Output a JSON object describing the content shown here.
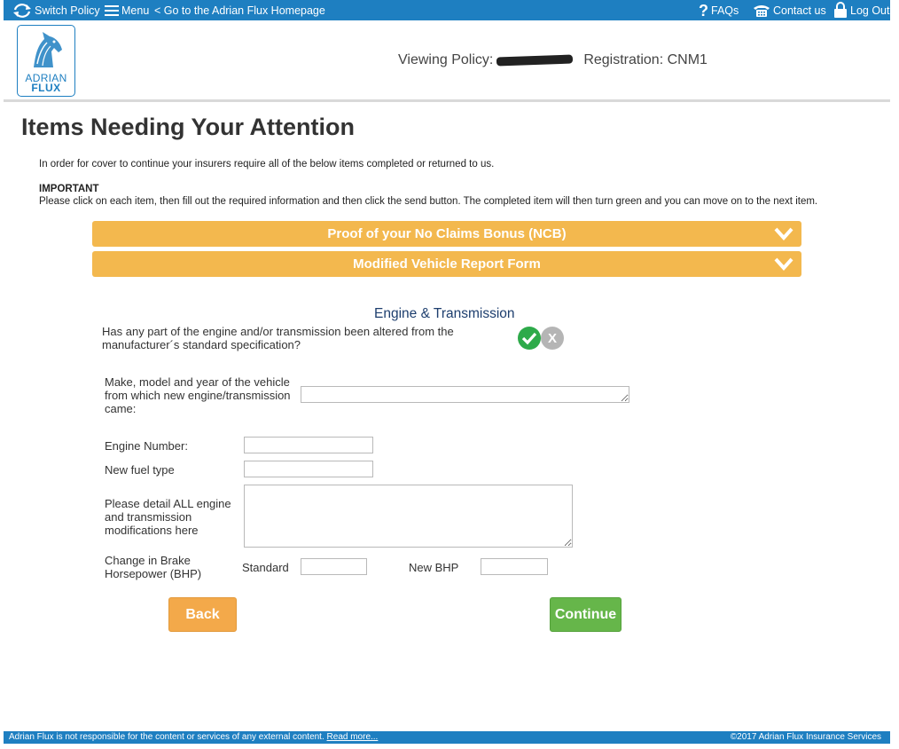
{
  "topbar": {
    "switch_policy": "Switch Policy",
    "menu": "Menu",
    "homepage_link": "< Go to the Adrian Flux Homepage",
    "faqs": "FAQs",
    "contact": "Contact us",
    "logout": "Log Out"
  },
  "header": {
    "logo_line1": "ADRIAN",
    "logo_line2": "FLUX",
    "viewing_policy_label": "Viewing Policy:",
    "registration": "Registration: CNM1"
  },
  "page": {
    "title": "Items Needing Your Attention",
    "intro": "In order for cover to continue your insurers require all of the below items completed or returned to us.",
    "important_label": "IMPORTANT",
    "instruction": "Please click on each item, then fill out the required information and then click the send button. The completed item will then turn green and you can move on to the next item."
  },
  "accordions": [
    {
      "label": "Proof of your No Claims Bonus (NCB)"
    },
    {
      "label": "Modified Vehicle Report Form"
    }
  ],
  "form": {
    "section_title": "Engine & Transmission",
    "altered_question": "Has any part of the engine and/or transmission been altered from the manufacturer´s standard specification?",
    "no_label": "X",
    "make_model_label": "Make, model and year of the vehicle from which new engine/transmission came:",
    "make_model_value": "",
    "engine_number_label": "Engine Number:",
    "engine_number_value": "",
    "fuel_type_label": "New fuel type",
    "fuel_type_value": "",
    "modifications_label": "Please detail ALL engine and transmission modifications here",
    "modifications_value": "",
    "bhp_label": "Change in Brake Horsepower (BHP)",
    "standard_label": "Standard",
    "standard_value": "",
    "new_bhp_label": "New BHP",
    "new_bhp_value": ""
  },
  "buttons": {
    "back": "Back",
    "continue": "Continue"
  },
  "footer": {
    "disclaimer": "Adrian Flux is not responsible for the content or services of any external content.",
    "read_more": "Read more...",
    "copyright": "©2017 Adrian Flux Insurance Services"
  },
  "colors": {
    "brand_blue": "#1e7fc1",
    "accordion_orange": "#f3b84e",
    "back_orange": "#f3a94a",
    "continue_green": "#66b64a",
    "yes_green": "#2eaa4a",
    "section_navy": "#1d3e6e"
  }
}
